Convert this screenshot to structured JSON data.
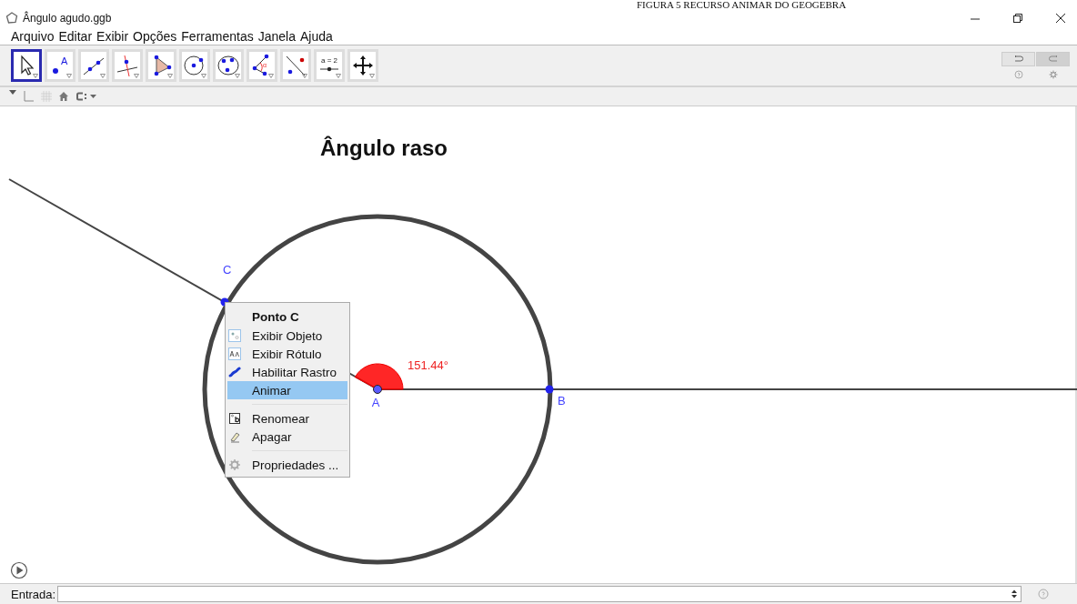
{
  "caption": "FIGURA 5 RECURSO ANIMAR DO GEOGEBRA",
  "window": {
    "title": "Ângulo agudo.ggb"
  },
  "menu": [
    "Arquivo",
    "Editar",
    "Exibir",
    "Opções",
    "Ferramentas",
    "Janela",
    "Ajuda"
  ],
  "toolbar": {
    "tools": [
      {
        "selected": true
      },
      {
        "selected": false,
        "icon_text": "A"
      },
      {
        "selected": false
      },
      {
        "selected": false
      },
      {
        "selected": false
      },
      {
        "selected": false
      },
      {
        "selected": false
      },
      {
        "selected": false,
        "icon_text": "α"
      },
      {
        "selected": false
      },
      {
        "selected": false,
        "icon_text": "a = 2"
      },
      {
        "selected": false
      }
    ]
  },
  "canvas": {
    "title": "Ângulo raso",
    "points": [
      {
        "label": "C"
      },
      {
        "label": "A"
      },
      {
        "label": "B"
      }
    ],
    "angle": {
      "label": "151.44°"
    }
  },
  "context_menu": {
    "items": [
      {
        "kind": "header",
        "label": "Ponto C"
      },
      {
        "kind": "item",
        "label": "Exibir Objeto",
        "selected": false
      },
      {
        "kind": "item",
        "label": "Exibir Rótulo",
        "selected": false
      },
      {
        "kind": "item",
        "label": "Habilitar Rastro",
        "selected": false
      },
      {
        "kind": "item",
        "label": "Animar",
        "selected": true
      },
      {
        "kind": "separator"
      },
      {
        "kind": "item",
        "label": "Renomear",
        "selected": false
      },
      {
        "kind": "item",
        "label": "Apagar",
        "selected": false
      },
      {
        "kind": "separator"
      },
      {
        "kind": "item",
        "label": "Propriedades ...",
        "selected": false
      }
    ]
  },
  "input_bar": {
    "label": "Entrada:"
  }
}
